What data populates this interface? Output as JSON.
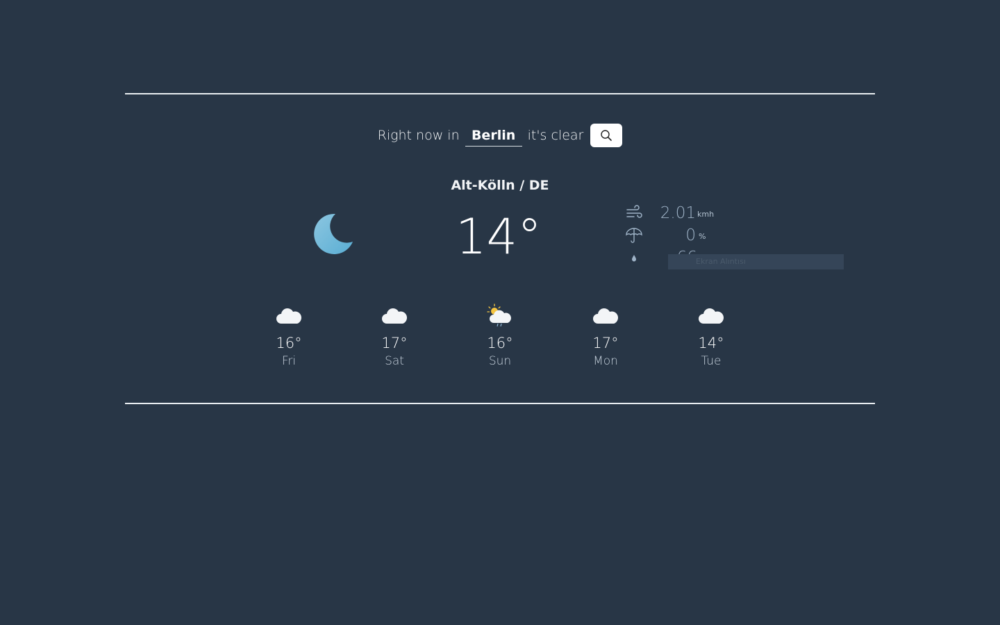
{
  "search": {
    "prefix": "Right now in",
    "city_value": "Berlin",
    "condition": "it's clear",
    "button_icon": "search-icon"
  },
  "location": "Alt-Kölln / DE",
  "current": {
    "icon": "moon-icon",
    "temperature": "14°"
  },
  "stats": {
    "wind_value": "2.01",
    "wind_unit": "kmh",
    "precip_value": "0",
    "precip_unit": "%",
    "humidity_value": "66",
    "humidity_unit": "%",
    "icons": [
      "wind-icon",
      "umbrella-icon",
      "droplet-icon"
    ]
  },
  "overlay": {
    "label": "Ekran Alıntısı"
  },
  "forecast": [
    {
      "icon": "cloud-icon",
      "temp": "16°",
      "day": "Fri"
    },
    {
      "icon": "cloud-icon",
      "temp": "17°",
      "day": "Sat"
    },
    {
      "icon": "sun-cloud-rain-icon",
      "temp": "16°",
      "day": "Sun"
    },
    {
      "icon": "cloud-icon",
      "temp": "17°",
      "day": "Mon"
    },
    {
      "icon": "cloud-icon",
      "temp": "14°",
      "day": "Tue"
    }
  ],
  "colors": {
    "background": "#283646",
    "moon": "#6fb7d8",
    "accent_text": "#9fb3c7"
  }
}
